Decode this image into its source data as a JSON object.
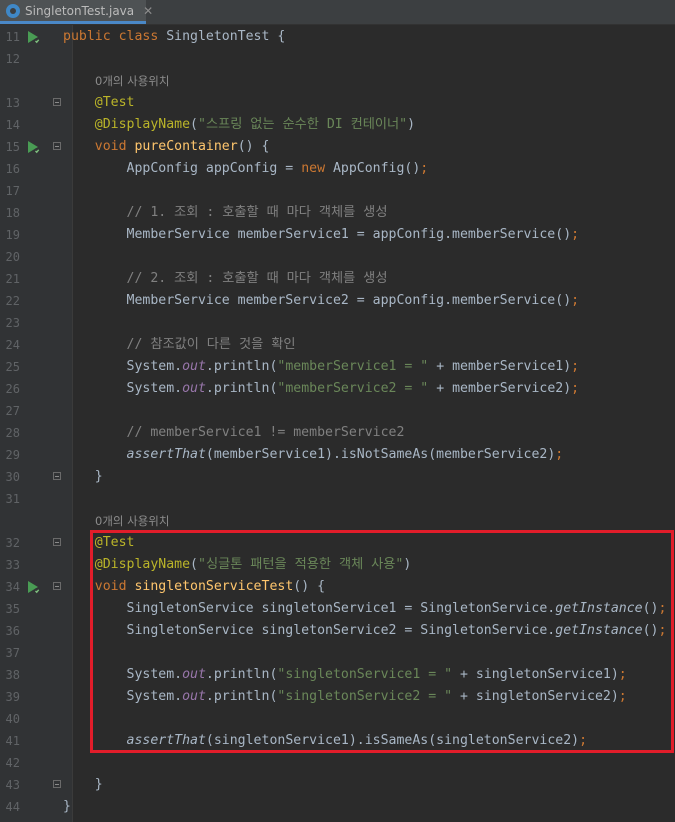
{
  "tab": {
    "filename": "SingletonTest.java",
    "close": "✕",
    "icon": "java-class-icon"
  },
  "hints": {
    "usage_a": "0개의 사용위치",
    "usage_b": "0개의 사용위치"
  },
  "lines": [
    {
      "num": "11",
      "code": [
        [
          "kw",
          "public "
        ],
        [
          "kw",
          "class "
        ],
        [
          "",
          "SingletonTest {"
        ]
      ],
      "run": true
    },
    {
      "num": "12",
      "code": []
    },
    {
      "num": "13",
      "code": [
        [
          "an",
          "    @Test"
        ]
      ],
      "fold": true
    },
    {
      "num": "14",
      "code": [
        [
          "an",
          "    @DisplayName"
        ],
        [
          "",
          "("
        ],
        [
          "str",
          "\"스프링 없는 순수한 DI 컨테이너\""
        ],
        [
          "",
          ")"
        ]
      ]
    },
    {
      "num": "15",
      "code": [
        [
          "kw",
          "    void "
        ],
        [
          "fn",
          "pureContainer"
        ],
        [
          "",
          "() {"
        ]
      ],
      "run": true,
      "fold": true
    },
    {
      "num": "16",
      "code": [
        [
          "",
          "        AppConfig appConfig = "
        ],
        [
          "kw",
          "new "
        ],
        [
          "",
          "AppConfig()"
        ],
        [
          "kw",
          ";"
        ]
      ]
    },
    {
      "num": "17",
      "code": []
    },
    {
      "num": "18",
      "code": [
        [
          "cm",
          "        // 1. 조회 : 호출할 때 마다 객체를 생성"
        ]
      ]
    },
    {
      "num": "19",
      "code": [
        [
          "",
          "        MemberService memberService1 = appConfig.memberService()"
        ],
        [
          "kw",
          ";"
        ]
      ]
    },
    {
      "num": "20",
      "code": []
    },
    {
      "num": "21",
      "code": [
        [
          "cm",
          "        // 2. 조회 : 호출할 때 마다 객체를 생성"
        ]
      ]
    },
    {
      "num": "22",
      "code": [
        [
          "",
          "        MemberService memberService2 = appConfig.memberService()"
        ],
        [
          "kw",
          ";"
        ]
      ]
    },
    {
      "num": "23",
      "code": []
    },
    {
      "num": "24",
      "code": [
        [
          "cm",
          "        // 참조값이 다른 것을 확인"
        ]
      ]
    },
    {
      "num": "25",
      "code": [
        [
          "",
          "        System."
        ],
        [
          "st",
          "out"
        ],
        [
          "",
          ".println("
        ],
        [
          "str",
          "\"memberService1 = \""
        ],
        [
          "",
          " + memberService1)"
        ],
        [
          "kw",
          ";"
        ]
      ]
    },
    {
      "num": "26",
      "code": [
        [
          "",
          "        System."
        ],
        [
          "st",
          "out"
        ],
        [
          "",
          ".println("
        ],
        [
          "str",
          "\"memberService2 = \""
        ],
        [
          "",
          " + memberService2)"
        ],
        [
          "kw",
          ";"
        ]
      ]
    },
    {
      "num": "27",
      "code": []
    },
    {
      "num": "28",
      "code": [
        [
          "cm",
          "        // memberService1 != memberService2"
        ]
      ]
    },
    {
      "num": "29",
      "code": [
        [
          "it",
          "        assertThat"
        ],
        [
          "",
          "(memberService1).isNotSameAs(memberService2)"
        ],
        [
          "kw",
          ";"
        ]
      ]
    },
    {
      "num": "30",
      "code": [
        [
          "",
          "    }"
        ]
      ],
      "fold": true
    },
    {
      "num": "31",
      "code": []
    },
    {
      "num": "32",
      "code": [
        [
          "an",
          "    @Test"
        ]
      ],
      "fold": true
    },
    {
      "num": "33",
      "code": [
        [
          "an",
          "    @DisplayName"
        ],
        [
          "",
          "("
        ],
        [
          "str",
          "\"싱글톤 패턴을 적용한 객체 사용\""
        ],
        [
          "",
          ")"
        ]
      ]
    },
    {
      "num": "34",
      "code": [
        [
          "kw",
          "    void "
        ],
        [
          "fn",
          "singletonServiceTest"
        ],
        [
          "",
          "() {"
        ]
      ],
      "run": true,
      "fold": true
    },
    {
      "num": "35",
      "code": [
        [
          "",
          "        SingletonService singletonService1 = SingletonService."
        ],
        [
          "it",
          "getInstance"
        ],
        [
          "",
          "()"
        ],
        [
          "kw",
          ";"
        ]
      ]
    },
    {
      "num": "36",
      "code": [
        [
          "",
          "        SingletonService singletonService2 = SingletonService."
        ],
        [
          "it",
          "getInstance"
        ],
        [
          "",
          "()"
        ],
        [
          "kw",
          ";"
        ]
      ]
    },
    {
      "num": "37",
      "code": []
    },
    {
      "num": "38",
      "code": [
        [
          "",
          "        System."
        ],
        [
          "st",
          "out"
        ],
        [
          "",
          ".println("
        ],
        [
          "str",
          "\"singletonService1 = \""
        ],
        [
          "",
          " + singletonService1)"
        ],
        [
          "kw",
          ";"
        ]
      ]
    },
    {
      "num": "39",
      "code": [
        [
          "",
          "        System."
        ],
        [
          "st",
          "out"
        ],
        [
          "",
          ".println("
        ],
        [
          "str",
          "\"singletonService2 = \""
        ],
        [
          "",
          " + singletonService2)"
        ],
        [
          "kw",
          ";"
        ]
      ]
    },
    {
      "num": "40",
      "code": []
    },
    {
      "num": "41",
      "code": [
        [
          "it",
          "        assertThat"
        ],
        [
          "",
          "(singletonService1).isSameAs(singletonService2)"
        ],
        [
          "kw",
          ";"
        ]
      ]
    },
    {
      "num": "42",
      "code": []
    },
    {
      "num": "43",
      "code": [
        [
          "",
          "    }"
        ]
      ],
      "fold": true
    },
    {
      "num": "44",
      "code": [
        [
          "",
          "}"
        ]
      ]
    }
  ],
  "colors": {
    "highlight_border": "#e11d2a",
    "background": "#2b2b2b"
  }
}
